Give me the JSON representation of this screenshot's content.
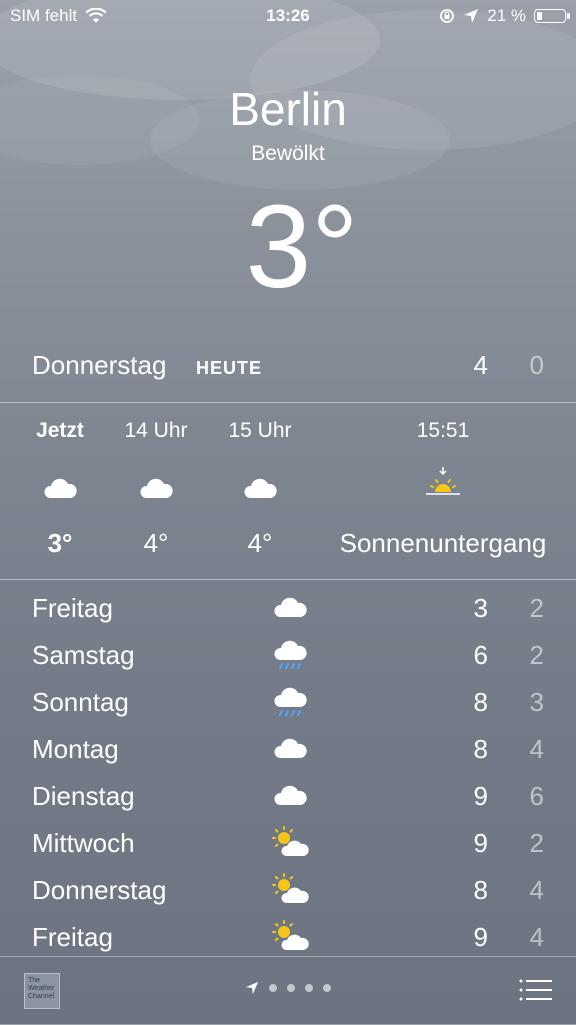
{
  "status_bar": {
    "carrier": "SIM fehlt",
    "time": "13:26",
    "battery": "21 %",
    "battery_level": 0.21
  },
  "location": {
    "city": "Berlin",
    "condition": "Bewölkt",
    "temperature": "3°"
  },
  "today": {
    "day": "Donnerstag",
    "badge": "HEUTE",
    "high": "4",
    "low": "0"
  },
  "hourly": [
    {
      "time": "Jetzt",
      "icon": "cloud-icon",
      "temp": "3°"
    },
    {
      "time": "14 Uhr",
      "icon": "cloud-icon",
      "temp": "4°"
    },
    {
      "time": "15 Uhr",
      "icon": "cloud-icon",
      "temp": "4°"
    },
    {
      "time": "15:51",
      "icon": "sunset-icon",
      "temp": "Sonnenuntergang"
    }
  ],
  "daily": [
    {
      "day": "Freitag",
      "icon": "cloud-icon",
      "high": "3",
      "low": "2"
    },
    {
      "day": "Samstag",
      "icon": "rain-cloud-icon",
      "high": "6",
      "low": "2"
    },
    {
      "day": "Sonntag",
      "icon": "rain-cloud-icon",
      "high": "8",
      "low": "3"
    },
    {
      "day": "Montag",
      "icon": "cloud-icon",
      "high": "8",
      "low": "4"
    },
    {
      "day": "Dienstag",
      "icon": "cloud-icon",
      "high": "9",
      "low": "6"
    },
    {
      "day": "Mittwoch",
      "icon": "partly-sunny-icon",
      "high": "9",
      "low": "2"
    },
    {
      "day": "Donnerstag",
      "icon": "partly-sunny-icon",
      "high": "8",
      "low": "4"
    },
    {
      "day": "Freitag",
      "icon": "partly-sunny-icon",
      "high": "9",
      "low": "4"
    }
  ],
  "footer": {
    "logo_text": "The Weather Channel",
    "page_dots": 4
  },
  "colors": {
    "sun": "#f5c518",
    "rain": "#4da6ff"
  }
}
